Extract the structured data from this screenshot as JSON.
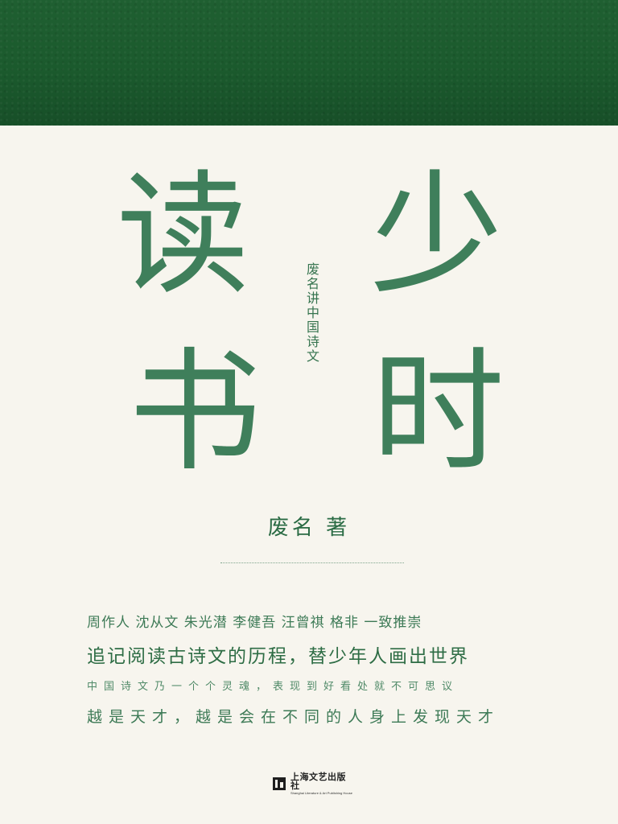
{
  "cover": {
    "title_chars": [
      "读",
      "少",
      "书",
      "时"
    ],
    "subtitle": "废名讲中国诗文",
    "author": "废名 著",
    "recommendation": "周作人 沈从文 朱光潜 李健吾 汪曾祺 格非 一致推崇",
    "tagline": "追记阅读古诗文的历程，替少年人画出世界",
    "quote_line_1": "中国诗文乃一个个灵魂，表现到好看处就不可思议",
    "quote_line_2": "越是天才，越是会在不同的人身上发现天才",
    "publisher_cn": "上海文艺出版社",
    "publisher_en": "Shanghai Literature & Art Publishing House"
  },
  "colors": {
    "band": "#1b5a2d",
    "accent": "#3f7f5b",
    "paper": "#f7f5ee"
  }
}
